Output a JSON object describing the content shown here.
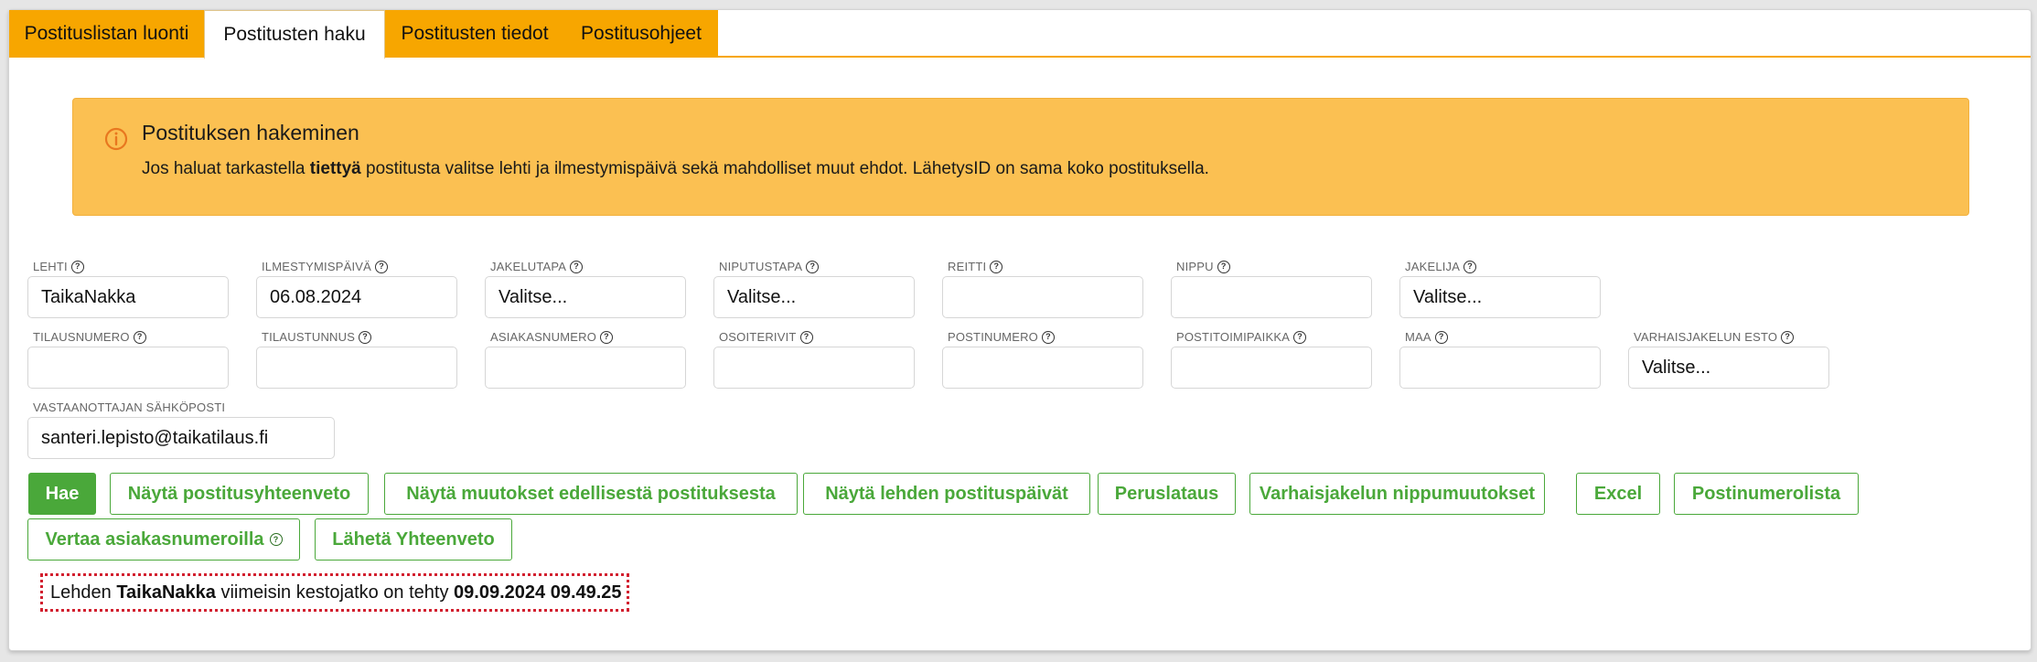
{
  "tabs": [
    {
      "label": "Postituslistan luonti"
    },
    {
      "label": "Postitusten haku"
    },
    {
      "label": "Postitusten tiedot"
    },
    {
      "label": "Postitusohjeet"
    }
  ],
  "alert": {
    "title": "Postituksen hakeminen",
    "text_before": "Jos haluat tarkastella ",
    "text_bold": "tiettyä",
    "text_after": " postitusta valitse lehti ja ilmestymispäivä sekä mahdolliset muut ehdot. LähetysID on sama koko postituksella."
  },
  "fields": {
    "lehti": {
      "label": "LEHTI",
      "value": "TaikaNakka"
    },
    "ilmestymispaiva": {
      "label": "ILMESTYMISPÄIVÄ",
      "value": "06.08.2024"
    },
    "jakelutapa": {
      "label": "JAKELUTAPA",
      "value": "Valitse..."
    },
    "niputustapa": {
      "label": "NIPUTUSTAPA",
      "value": "Valitse..."
    },
    "reitti": {
      "label": "REITTI",
      "value": ""
    },
    "nippu": {
      "label": "NIPPU",
      "value": ""
    },
    "jakelija": {
      "label": "JAKELIJA",
      "value": "Valitse..."
    },
    "tilausnumero": {
      "label": "TILAUSNUMERO",
      "value": ""
    },
    "tilaustunnus": {
      "label": "TILAUSTUNNUS",
      "value": ""
    },
    "asiakasnumero": {
      "label": "ASIAKASNUMERO",
      "value": ""
    },
    "osoiterivit": {
      "label": "OSOITERIVIT",
      "value": ""
    },
    "postinumero": {
      "label": "POSTINUMERO",
      "value": ""
    },
    "postitoimipaikka": {
      "label": "POSTITOIMIPAIKKA",
      "value": ""
    },
    "maa": {
      "label": "MAA",
      "value": ""
    },
    "varhaisjakelun_esto": {
      "label": "VARHAISJAKELUN ESTO",
      "value": "Valitse..."
    },
    "sahkoposti": {
      "label": "VASTAANOTTAJAN SÄHKÖPOSTI",
      "value": "santeri.lepisto@taikatilaus.fi"
    }
  },
  "buttons": {
    "hae": "Hae",
    "yhteenveto": "Näytä postitusyhteenveto",
    "muutokset": "Näytä muutokset edellisestä postituksesta",
    "postituspaivat": "Näytä lehden postituspäivät",
    "peruslataus": "Peruslataus",
    "nippumuutokset": "Varhaisjakelun nippumuutokset",
    "excel": "Excel",
    "postinumerolista": "Postinumerolista",
    "vertaa": "Vertaa asiakasnumeroilla",
    "laheta": "Lähetä Yhteenveto"
  },
  "help_glyph": "?",
  "notice": {
    "prefix": "Lehden ",
    "paper": "TaikaNakka",
    "middle": " viimeisin kestojatko on tehty ",
    "datetime": "09.09.2024 09.49.25"
  },
  "colors": {
    "tab_orange": "#f7a600",
    "alert_bg": "#fbc052",
    "button_green": "#4aa83a",
    "notice_border": "#d2202f"
  }
}
